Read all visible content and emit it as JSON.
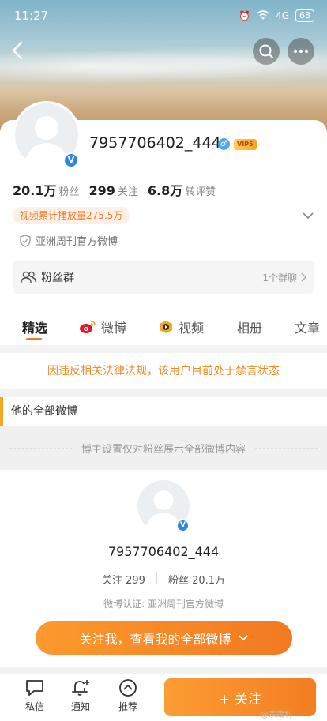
{
  "status": {
    "time": "11:27",
    "signal": "4G",
    "battery": "68"
  },
  "profile": {
    "username": "7957706402_444",
    "vip_label": "VIP5",
    "followers_count": "20.1万",
    "followers_label": "粉丝",
    "following_count": "299",
    "following_label": "关注",
    "reposts_count": "6.8万",
    "reposts_label": "转评赞",
    "video_play": "视频累计播放量275.5万",
    "certification": "亚洲周刊官方微博"
  },
  "fans_group": {
    "label": "粉丝群",
    "count_text": "1个群聊"
  },
  "tabs": [
    {
      "label": "精选"
    },
    {
      "label": "微博"
    },
    {
      "label": "视频"
    },
    {
      "label": "相册"
    },
    {
      "label": "文章"
    }
  ],
  "ban_notice": "因违反相关法律法规，该用户目前处于禁言状态",
  "section_title": "他的全部微博",
  "fans_only_text": "博主设置仅对粉丝展示全部微博内容",
  "follow_card": {
    "username": "7957706402_444",
    "following": "关注 299",
    "followers": "粉丝 20.1万",
    "certification": "微博认证: 亚洲周刊官方微博",
    "cta": "关注我，查看我的全部微博"
  },
  "bottom_bar": {
    "message": "私信",
    "notify": "通知",
    "recommend": "推荐",
    "follow": "+ 关注"
  },
  "watermark": "@宗箴利",
  "colors": {
    "accent": "#f07a29",
    "verified_blue": "#2e86e0"
  }
}
